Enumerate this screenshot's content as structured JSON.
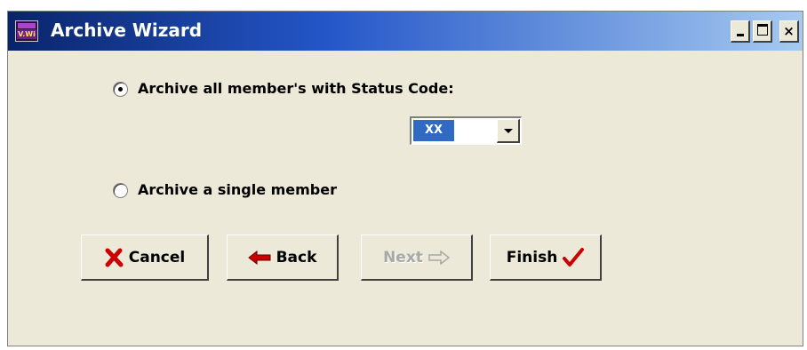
{
  "window": {
    "title": "Archive Wizard",
    "icon_text": "V.Wi",
    "controls": {
      "minimize": "minimize-icon",
      "maximize": "maximize-icon",
      "close_label": "×"
    }
  },
  "options": {
    "by_status_label": "Archive all member's with Status Code:",
    "by_status_selected": true,
    "single_member_label": "Archive a single member",
    "single_member_selected": false
  },
  "status_code": {
    "value": "XX"
  },
  "buttons": {
    "cancel": {
      "label": "Cancel",
      "icon": "red-x-icon",
      "color": "#cc0000"
    },
    "back": {
      "label": "Back",
      "icon": "red-arrow-left-icon",
      "color": "#cc0000"
    },
    "next": {
      "label": "Next",
      "icon": "arrow-right-icon",
      "enabled": false
    },
    "finish": {
      "label": "Finish",
      "icon": "red-checkmark-icon",
      "color": "#cc0000"
    }
  },
  "colors": {
    "titlebar_start": "#0a246a",
    "titlebar_end": "#a6caf0",
    "window_bg": "#ece9d8",
    "selection": "#316ac5"
  }
}
